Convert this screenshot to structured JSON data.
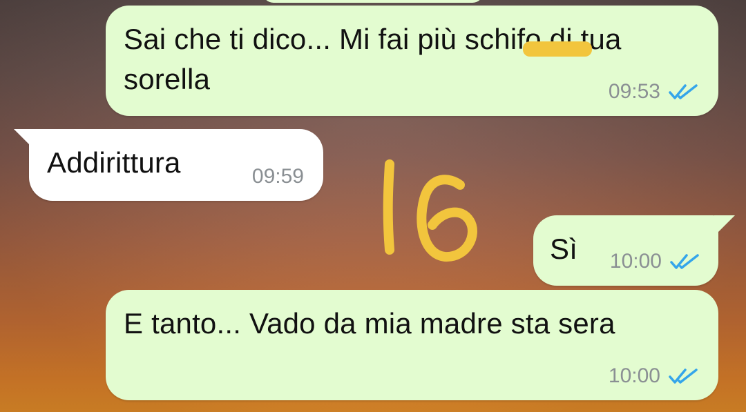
{
  "messages": [
    {
      "direction": "outgoing",
      "text_line1": "Sai che ti dico... Mi fai più schifo di tua",
      "text_line2": "sorella",
      "time": "09:53",
      "status": "read"
    },
    {
      "direction": "incoming",
      "text": "Addirittura",
      "time": "09:59"
    },
    {
      "direction": "outgoing",
      "text": "Sì",
      "time": "10:00",
      "status": "read"
    },
    {
      "direction": "outgoing",
      "text": "E tanto... Vado da mia madre sta sera",
      "time": "10:00",
      "status": "read"
    }
  ],
  "annotation": {
    "text": "16",
    "color": "#f2c53d"
  },
  "colors": {
    "outgoing_bubble": "#e3fcd0",
    "incoming_bubble": "#ffffff",
    "read_ticks": "#34a5ea",
    "timestamp": "#8a8f93"
  }
}
